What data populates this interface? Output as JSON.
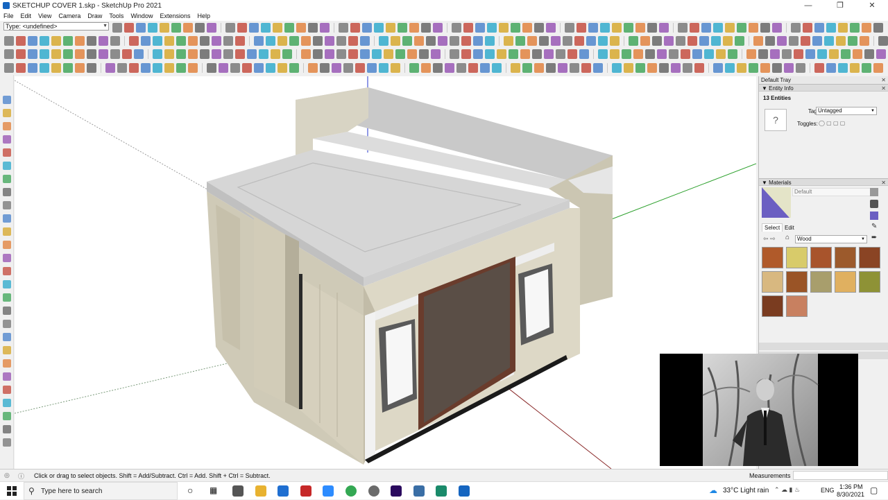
{
  "window": {
    "title": "SKETCHUP COVER 1.skp - SketchUp Pro 2021"
  },
  "menu": [
    "File",
    "Edit",
    "View",
    "Camera",
    "Draw",
    "Tools",
    "Window",
    "Extensions",
    "Help"
  ],
  "toolbar": {
    "type_selector": "Type: <undefined>"
  },
  "tray": {
    "title": "Default Tray",
    "entity_info": {
      "header": "Entity Info",
      "count": "13 Entities",
      "tag_label": "Tag:",
      "tag_value": "Untagged",
      "toggles_label": "Toggles:",
      "preview_symbol": "?"
    },
    "materials": {
      "header": "Materials",
      "default_name": "Default",
      "tab_select": "Select",
      "tab_edit": "Edit",
      "collection": "Wood",
      "swatch_colors": [
        "#b05a2a",
        "#d8cb6a",
        "#a8542c",
        "#9c5a2c",
        "#8a4424",
        "#d8b880",
        "#9a5426",
        "#a89e6c",
        "#e0b060",
        "#8e9236",
        "#7a3c20",
        "#c88060"
      ]
    }
  },
  "status": {
    "hint": "Click or drag to select objects. Shift = Add/Subtract. Ctrl = Add. Shift + Ctrl = Subtract.",
    "measurements_label": "Measurements"
  },
  "taskbar": {
    "search_placeholder": "Type here to search",
    "weather": "33°C  Light rain",
    "language": "ENG",
    "time": "1:36 PM",
    "date": "8/30/2021"
  }
}
